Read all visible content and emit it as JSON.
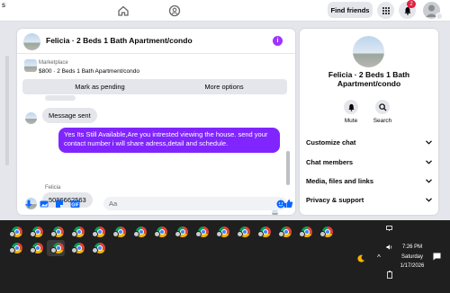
{
  "topbar": {
    "left_fragment": "s",
    "find_friends_label": "Find friends",
    "notification_count": "2"
  },
  "chat": {
    "title": "Felicia · 2 Beds 1 Bath Apartment/condo",
    "info_icon": "i",
    "marketplace_label": "Marketplace",
    "listing": "$800 · 2 Beds 1 Bath Apartment/condo",
    "mark_pending_label": "Mark as pending",
    "more_options_label": "More options",
    "messages": [
      {
        "from": "other",
        "text": "Message sent"
      },
      {
        "from": "me",
        "text": "Yes Its Still Available,Are you intrested viewing the house. send your contact number i will share adress,detail and schedule."
      },
      {
        "from": "other",
        "sender": "Felicia",
        "text": "5096662563"
      }
    ],
    "composer_placeholder": "Aa"
  },
  "info": {
    "title": "Felicia · 2 Beds 1 Bath Apartment/condo",
    "mute_label": "Mute",
    "search_label": "Search",
    "sections": [
      "Customize chat",
      "Chat members",
      "Media, files and links",
      "Privacy & support"
    ]
  },
  "taskbar": {
    "time": "7:26 PM",
    "day": "Saturday",
    "date": "1/17/2026"
  },
  "colors": {
    "accent": "#8125ff",
    "info_badge": "#a033ff",
    "messenger_blue": "#0866ff",
    "notif_red": "#e41e3f"
  }
}
